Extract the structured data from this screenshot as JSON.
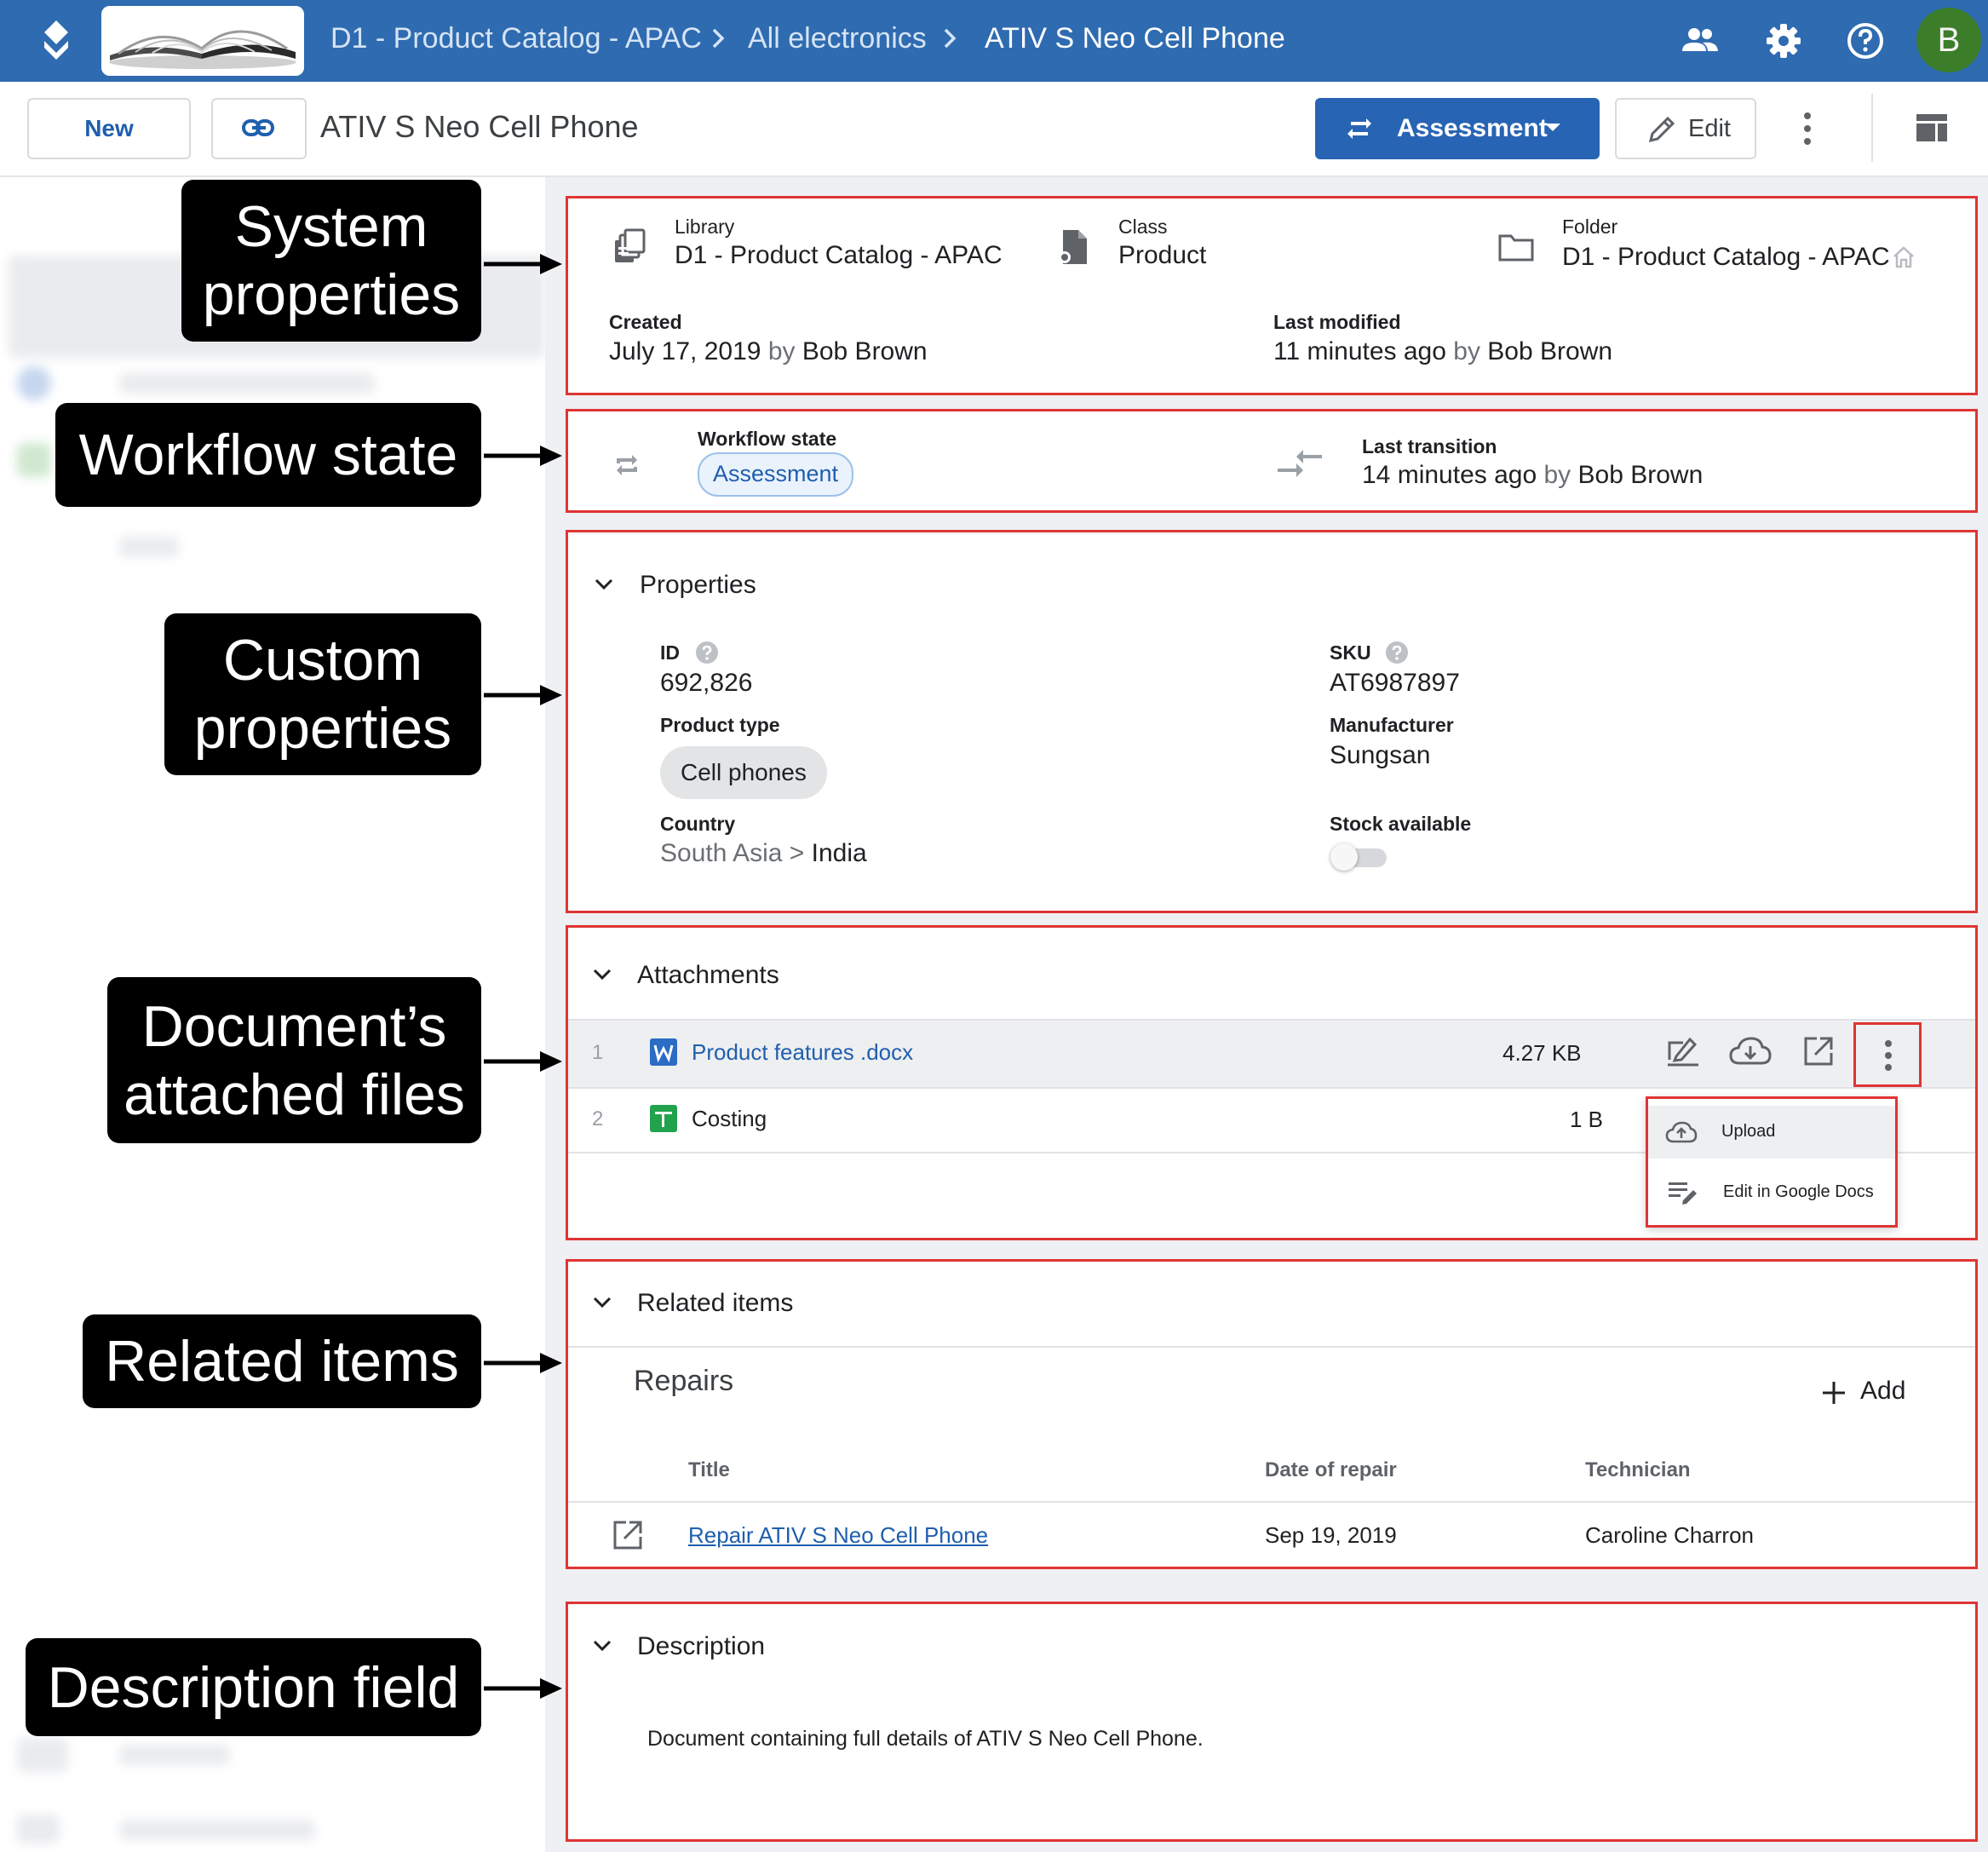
{
  "topbar": {
    "breadcrumbs": [
      "D1 - Product Catalog - APAC",
      "All electronics",
      "ATIV S Neo Cell Phone"
    ],
    "avatar_initial": "B",
    "icons": [
      "people-icon",
      "gear-icon",
      "help-icon"
    ]
  },
  "toolbar": {
    "new_label": "New",
    "link_icon": "link-icon",
    "title": "ATIV S Neo Cell Phone",
    "assessment_label": "Assessment",
    "edit_label": "Edit"
  },
  "system_properties": {
    "library_label": "Library",
    "library_value": "D1 - Product Catalog - APAC",
    "class_label": "Class",
    "class_value": "Product",
    "folder_label": "Folder",
    "folder_value": "D1 - Product Catalog - APAC",
    "created_label": "Created",
    "created_date": "July 17, 2019",
    "by_word": "by",
    "created_by": "Bob Brown",
    "modified_label": "Last modified",
    "modified_when": "11 minutes ago",
    "modified_by": "Bob Brown"
  },
  "workflow": {
    "state_label": "Workflow state",
    "state_value": "Assessment",
    "transition_label": "Last transition",
    "transition_when": "14 minutes ago",
    "transition_by": "Bob Brown"
  },
  "properties": {
    "section_title": "Properties",
    "id_label": "ID",
    "id_value": "692,826",
    "sku_label": "SKU",
    "sku_value": "AT6987897",
    "product_type_label": "Product type",
    "product_type_value": "Cell phones",
    "manufacturer_label": "Manufacturer",
    "manufacturer_value": "Sungsan",
    "country_label": "Country",
    "country_region": "South Asia",
    "country_sep": ">",
    "country_value": "India",
    "stock_label": "Stock available",
    "stock_on": false
  },
  "attachments": {
    "section_title": "Attachments",
    "files": [
      {
        "index": "1",
        "name": "Product features .docx",
        "size": "4.27 KB",
        "type_icon": "word-doc-icon"
      },
      {
        "index": "2",
        "name": "Costing",
        "size": "1 B",
        "type_icon": "sheets-icon"
      }
    ],
    "menu": [
      "Upload",
      "Edit in Google Docs"
    ]
  },
  "related": {
    "section_title": "Related items",
    "group_title": "Repairs",
    "add_label": "Add",
    "columns": [
      "Title",
      "Date of repair",
      "Technician"
    ],
    "rows": [
      {
        "title": "Repair ATIV S Neo Cell Phone",
        "date": "Sep 19, 2019",
        "technician": "Caroline Charron"
      }
    ]
  },
  "description": {
    "section_title": "Description",
    "text": "Document containing full details of ATIV S Neo Cell Phone."
  },
  "callouts": {
    "system": [
      "System",
      "properties"
    ],
    "workflow": [
      "Workflow state"
    ],
    "custom": [
      "Custom",
      "properties"
    ],
    "attached": [
      "Document’s",
      "attached files"
    ],
    "related": [
      "Related items"
    ],
    "description": [
      "Description field"
    ]
  },
  "colors": {
    "topbar": "#2f6bb0",
    "accent": "#2864b4",
    "highlight_border": "#e03434",
    "callout_bg": "#000000",
    "avatar": "#3c7d29"
  }
}
